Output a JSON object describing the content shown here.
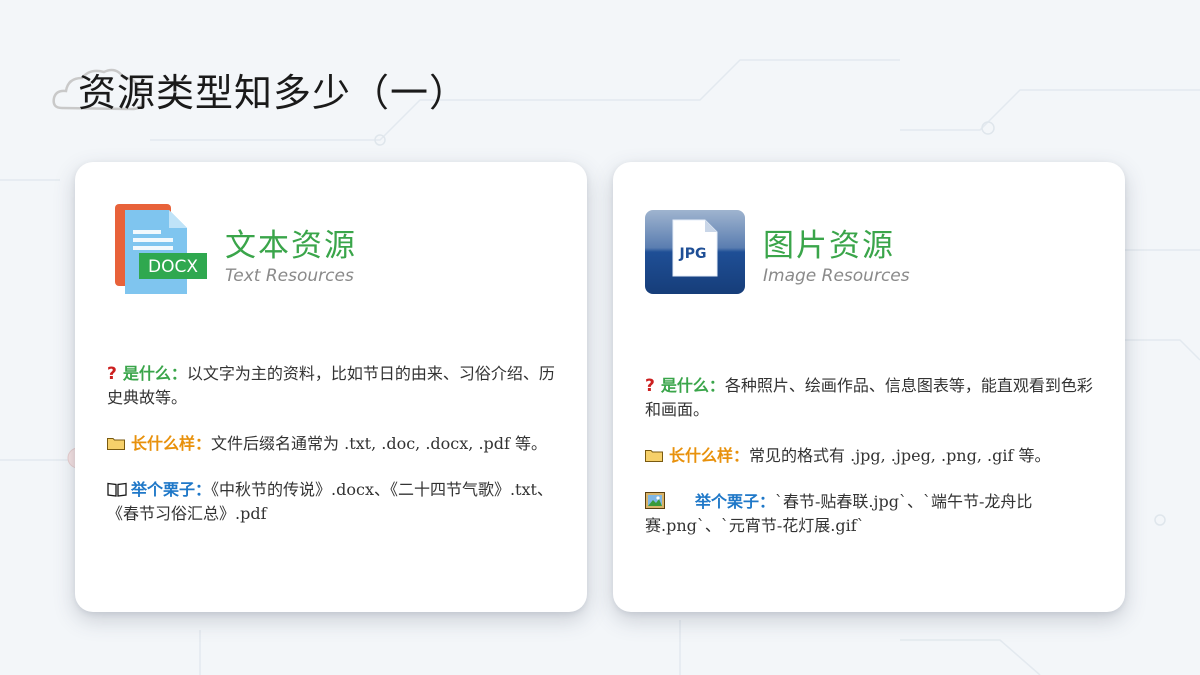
{
  "page": {
    "title": "资源类型知多少（一）"
  },
  "colors": {
    "title_green": "#3aa54a",
    "label_orange": "#e8910c",
    "label_blue": "#1f78c8",
    "question_red": "#cc1f1f"
  },
  "cards": [
    {
      "icon": "docx-file-icon",
      "icon_text": "DOCX",
      "title": "文本资源",
      "subtitle": "Text Resources",
      "what": {
        "label": "是什么：",
        "text": "以文字为主的资料，比如节日的由来、习俗介绍、历史典故等。"
      },
      "looks": {
        "label": "长什么样：",
        "text": "文件后缀名通常为 .txt, .doc, .docx, .pdf 等。"
      },
      "example": {
        "label": "举个栗子：",
        "text": "《中秋节的传说》.docx、《二十四节气歌》.txt、《春节习俗汇总》.pdf"
      }
    },
    {
      "icon": "jpg-file-icon",
      "icon_text": "JPG",
      "title": "图片资源",
      "subtitle": "Image Resources",
      "what": {
        "label": "是什么：",
        "text": "各种照片、绘画作品、信息图表等，能直观看到色彩和画面。"
      },
      "looks": {
        "label": "长什么样：",
        "text": "常见的格式有 .jpg, .jpeg, .png, .gif 等。"
      },
      "example": {
        "label": "举个栗子：",
        "text": "`春节-贴春联.jpg`、`端午节-龙舟比赛.png`、`元宵节-花灯展.gif`"
      }
    }
  ]
}
